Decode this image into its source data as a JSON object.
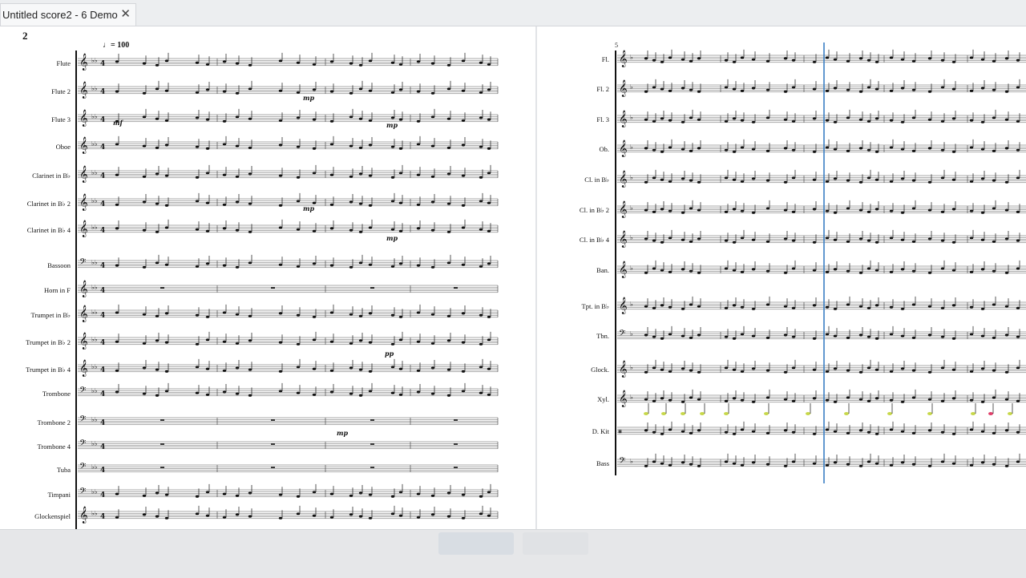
{
  "window": {
    "tab_title": "Untitled score2 - 6 Demo",
    "close_icon": "close-icon"
  },
  "score": {
    "page_number": "2",
    "tempo_marking": "♩= 100",
    "right_measure_number": "5",
    "left_instruments": [
      "Flute",
      "Flute 2",
      "Flute 3",
      "Oboe",
      "Clarinet in B♭",
      "Clarinet in B♭ 2",
      "Clarinet in B♭ 4",
      "Bassoon",
      "Horn in F",
      "Trumpet in B♭",
      "Trumpet in B♭ 2",
      "Trumpet in B♭ 4",
      "Trombone",
      "Trombone 2",
      "Trombone 4",
      "Tuba",
      "Timpani",
      "Glockenspiel"
    ],
    "right_instruments": [
      "Fl.",
      "Fl. 2",
      "Fl. 3",
      "Ob.",
      "Cl. in B♭",
      "Cl. in B♭ 2",
      "Cl. in B♭ 4",
      "Ban.",
      "Tpt. in B♭",
      "Tbn.",
      "Glock.",
      "Xyl.",
      "D. Kit",
      "Bass"
    ],
    "dynamics": [
      "mf",
      "mp",
      "pp"
    ],
    "playback_cursor_color": "#3a7fc4",
    "xylophone_note_colors": [
      "#c8d84a",
      "#e0406a"
    ]
  },
  "bottom_panel": {
    "button_1": "",
    "button_2": ""
  }
}
